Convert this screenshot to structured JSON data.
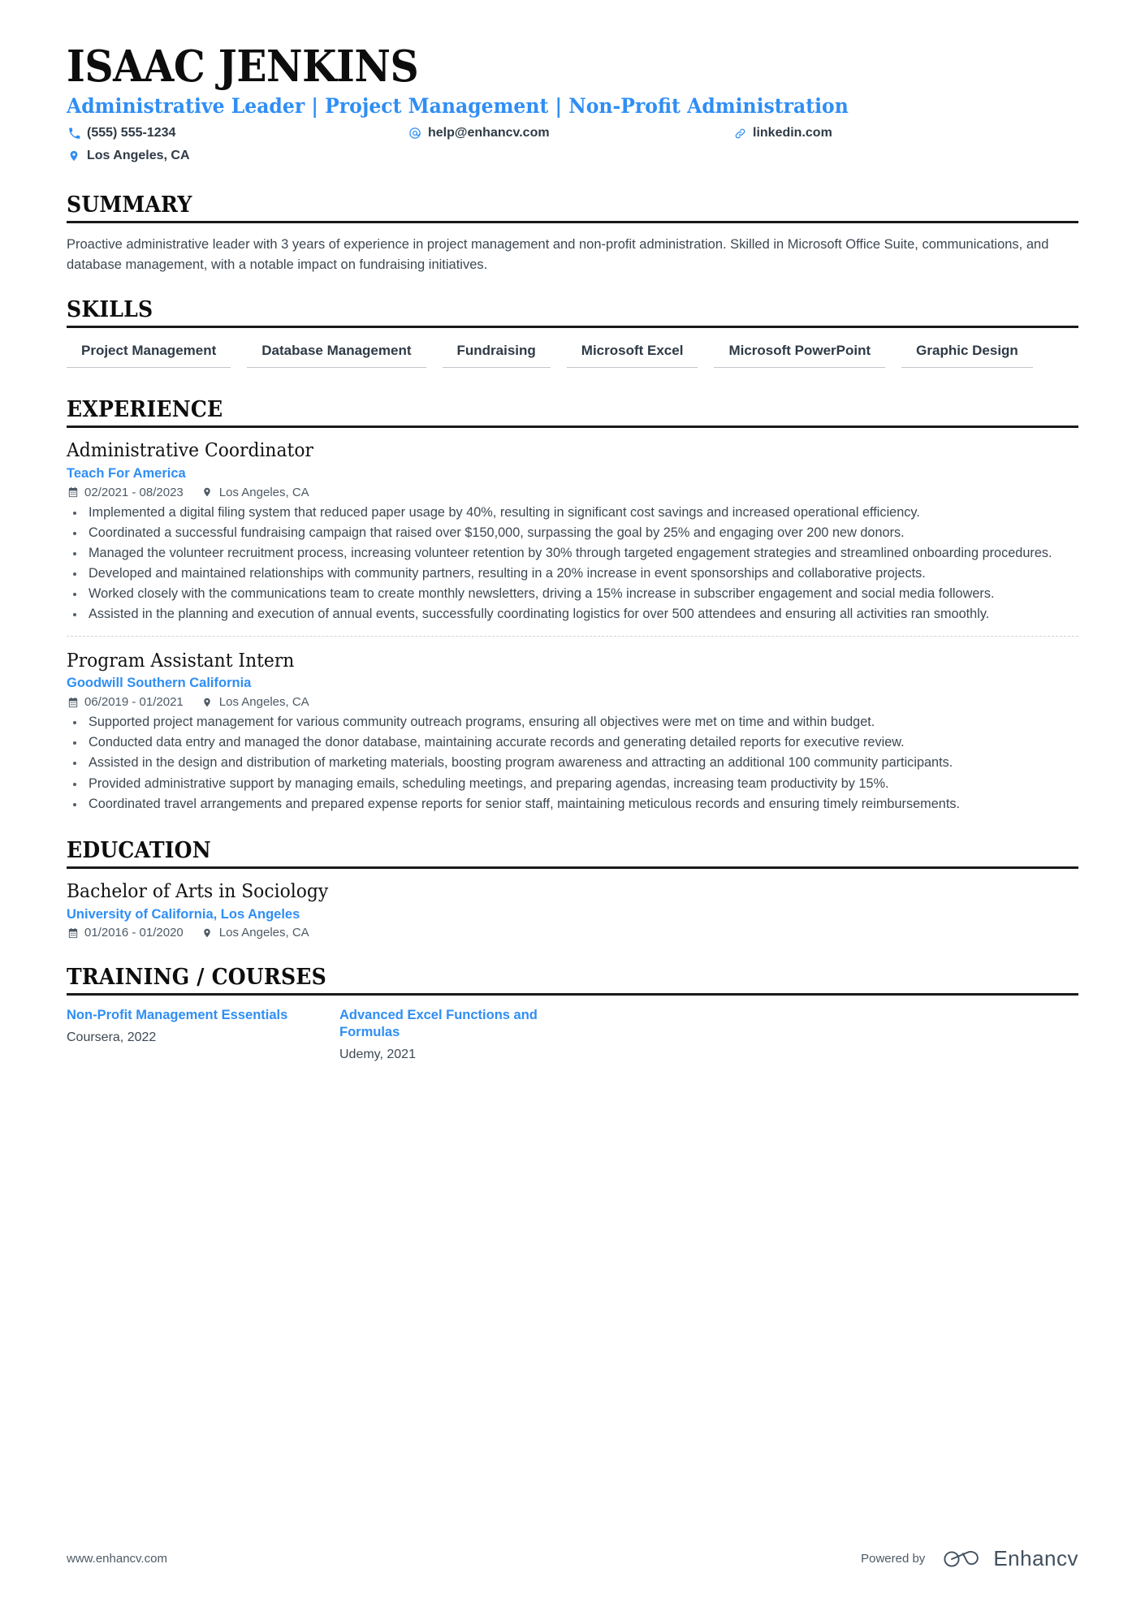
{
  "header": {
    "name": "ISAAC JENKINS",
    "headline": "Administrative Leader | Project Management | Non-Profit Administration",
    "contacts": [
      {
        "icon": "phone-icon",
        "text": "(555) 555-1234"
      },
      {
        "icon": "email-icon",
        "text": "help@enhancv.com"
      },
      {
        "icon": "link-icon",
        "text": "linkedin.com"
      },
      {
        "icon": "location-icon",
        "text": "Los Angeles, CA"
      }
    ]
  },
  "sections": {
    "summary": {
      "title": "SUMMARY",
      "text": "Proactive administrative leader with 3 years of experience in project management and non-profit administration. Skilled in Microsoft Office Suite, communications, and database management, with a notable impact on fundraising initiatives."
    },
    "skills": {
      "title": "SKILLS",
      "items": [
        "Project Management",
        "Database Management",
        "Fundraising",
        "Microsoft Excel",
        "Microsoft PowerPoint",
        "Graphic Design"
      ]
    },
    "experience": {
      "title": "EXPERIENCE",
      "entries": [
        {
          "role": "Administrative Coordinator",
          "org": "Teach For America",
          "dates": "02/2021 - 08/2023",
          "location": "Los Angeles, CA",
          "bullets": [
            "Implemented a digital filing system that reduced paper usage by 40%, resulting in significant cost savings and increased operational efficiency.",
            "Coordinated a successful fundraising campaign that raised over $150,000, surpassing the goal by 25% and engaging over 200 new donors.",
            "Managed the volunteer recruitment process, increasing volunteer retention by 30% through targeted engagement strategies and streamlined onboarding procedures.",
            "Developed and maintained relationships with community partners, resulting in a 20% increase in event sponsorships and collaborative projects.",
            "Worked closely with the communications team to create monthly newsletters, driving a 15% increase in subscriber engagement and social media followers.",
            "Assisted in the planning and execution of annual events, successfully coordinating logistics for over 500 attendees and ensuring all activities ran smoothly."
          ]
        },
        {
          "role": "Program Assistant Intern",
          "org": "Goodwill Southern California",
          "dates": "06/2019 - 01/2021",
          "location": "Los Angeles, CA",
          "bullets": [
            "Supported project management for various community outreach programs, ensuring all objectives were met on time and within budget.",
            "Conducted data entry and managed the donor database, maintaining accurate records and generating detailed reports for executive review.",
            "Assisted in the design and distribution of marketing materials, boosting program awareness and attracting an additional 100 community participants.",
            "Provided administrative support by managing emails, scheduling meetings, and preparing agendas, increasing team productivity by 15%.",
            "Coordinated travel arrangements and prepared expense reports for senior staff, maintaining meticulous records and ensuring timely reimbursements."
          ]
        }
      ]
    },
    "education": {
      "title": "EDUCATION",
      "entries": [
        {
          "degree": "Bachelor of Arts in Sociology",
          "school": "University of California, Los Angeles",
          "dates": "01/2016 - 01/2020",
          "location": "Los Angeles, CA"
        }
      ]
    },
    "training": {
      "title": "TRAINING / COURSES",
      "courses": [
        {
          "name": "Non-Profit Management Essentials",
          "meta": "Coursera, 2022"
        },
        {
          "name": "Advanced Excel Functions and Formulas",
          "meta": "Udemy, 2021"
        }
      ]
    }
  },
  "footer": {
    "url": "www.enhancv.com",
    "powered_label": "Powered by",
    "brand": "Enhancv"
  },
  "colors": {
    "accent": "#2f8ef4",
    "text": "#3d4852",
    "heading": "#0d0d0d",
    "rule": "#1a1a1a"
  }
}
